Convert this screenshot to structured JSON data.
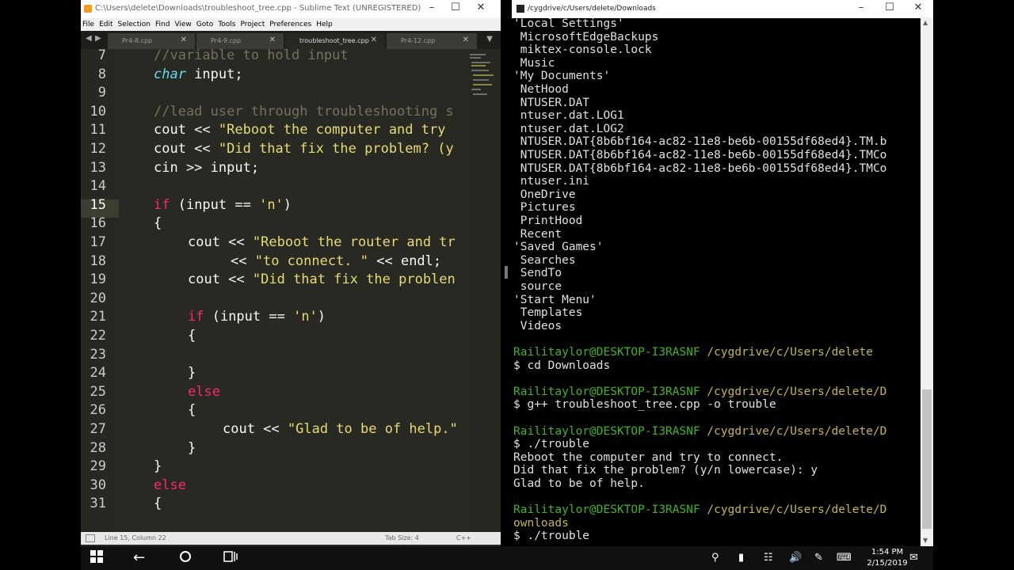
{
  "sublime": {
    "title": "C:\\Users\\delete\\Downloads\\troubleshoot_tree.cpp - Sublime Text (UNREGISTERED)",
    "menu": [
      "File",
      "Edit",
      "Selection",
      "Find",
      "View",
      "Goto",
      "Tools",
      "Project",
      "Preferences",
      "Help"
    ],
    "tabs": [
      {
        "label": "Pr4-8.cpp"
      },
      {
        "label": "Pr4-9.cpp"
      },
      {
        "label": "troubleshoot_tree.cpp"
      },
      {
        "label": "Pr4-12.cpp"
      }
    ],
    "line_numbers": [
      "7",
      "8",
      "9",
      "10",
      "11",
      "12",
      "13",
      "14",
      "15",
      "16",
      "17",
      "18",
      "19",
      "20",
      "21",
      "22",
      "23",
      "24",
      "25",
      "26",
      "27",
      "28",
      "29",
      "30",
      "31"
    ],
    "status": {
      "position": "Line 15, Column 22",
      "tab_size": "Tab Size: 4",
      "syntax": "C++"
    }
  },
  "code": {
    "l7": "//variable to hold input",
    "l8_type": "char",
    "l8_rest": " input;",
    "l10": "//lead user through troubleshooting s",
    "l11_a": "cout << ",
    "l11_s": "\"Reboot the computer and try",
    "l12_a": "cout << ",
    "l12_s": "\"Did that fix the problem? (y",
    "l13": "cin >> input;",
    "l15_kw": "if",
    "l15_a": " (input == ",
    "l15_s": "'n'",
    "l15_b": ")",
    "brace_open": "{",
    "brace_close": "}",
    "l17_a": "cout << ",
    "l17_s": "\"Reboot the router and tr",
    "l18_a": "<< ",
    "l18_s": "\"to connect. \"",
    "l18_b": " << endl;",
    "l19_a": "cout << ",
    "l19_s": "\"Did that fix the problen",
    "l21_kw": "if",
    "l21_a": " (input == ",
    "l21_s": "'n'",
    "l21_b": ")",
    "else_kw": "else",
    "l27_a": "cout << ",
    "l27_s": "\"Glad to be of help.\""
  },
  "terminal": {
    "title": "/cygdrive/c/Users/delete/Downloads",
    "listing": [
      "'Local Settings'",
      " MicrosoftEdgeBackups",
      " miktex-console.lock",
      " Music",
      "'My Documents'",
      " NetHood",
      " NTUSER.DAT",
      " ntuser.dat.LOG1",
      " ntuser.dat.LOG2",
      " NTUSER.DAT{8b6bf164-ac82-11e8-be6b-00155df68ed4}.TM.b",
      " NTUSER.DAT{8b6bf164-ac82-11e8-be6b-00155df68ed4}.TMCo",
      " NTUSER.DAT{8b6bf164-ac82-11e8-be6b-00155df68ed4}.TMCo",
      " ntuser.ini",
      " OneDrive",
      " Pictures",
      " PrintHood",
      " Recent",
      "'Saved Games'",
      " Searches",
      " SendTo",
      " source",
      "'Start Menu'",
      " Templates",
      " Videos"
    ],
    "user": "Railitaylor@DESKTOP-I3RASNF",
    "path1": " /cygdrive/c/Users/delete",
    "cmd1": "$ cd Downloads",
    "path2": " /cygdrive/c/Users/delete/D",
    "cmd2": "$ g++ troubleshoot_tree.cpp -o trouble",
    "path3": " /cygdrive/c/Users/delete/D",
    "cmd3": "$ ./trouble",
    "out1": "Reboot the computer and try to connect.",
    "out2": "Did that fix the problem? (y/n lowercase): y",
    "out3": "Glad to be of help.",
    "path4": " /cygdrive/c/Users/delete/D",
    "path4_cont": "ownloads",
    "cmd4": "$ ./trouble"
  },
  "taskbar": {
    "time": "1:54 PM",
    "date": "2/15/2019"
  },
  "colors": {
    "editor_bg": "#272822",
    "keyword": "#f92672",
    "string": "#e6db74",
    "comment": "#75715e",
    "type": "#66d9ef",
    "prompt_green": "#3fb618",
    "prompt_yellow": "#c4b73e"
  }
}
